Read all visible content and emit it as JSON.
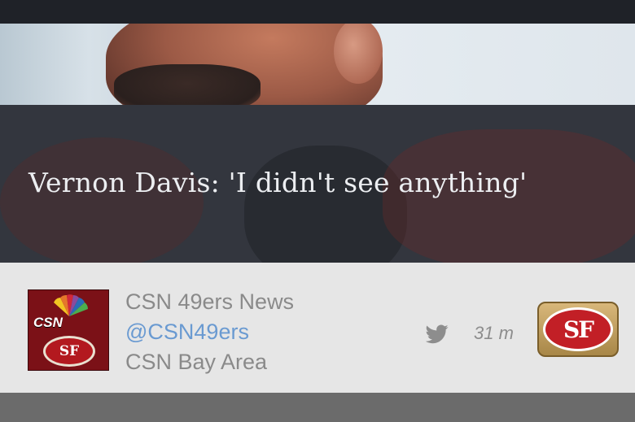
{
  "article": {
    "headline": "Vernon Davis: 'I didn't see anything'"
  },
  "source": {
    "name": "CSN 49ers News",
    "handle": "@CSN49ers",
    "network": "CSN Bay Area",
    "logo_text": "CSN",
    "logo_badge": "SF",
    "icon": "twitter-icon",
    "time_ago": "31 m"
  },
  "team": {
    "logo_text": "SF",
    "primary_color": "#c21f26",
    "gold_color": "#b08f4c"
  },
  "colors": {
    "handle": "#6a9ad1",
    "card_bg": "#e6e6e6",
    "overlay": "#33363e"
  }
}
